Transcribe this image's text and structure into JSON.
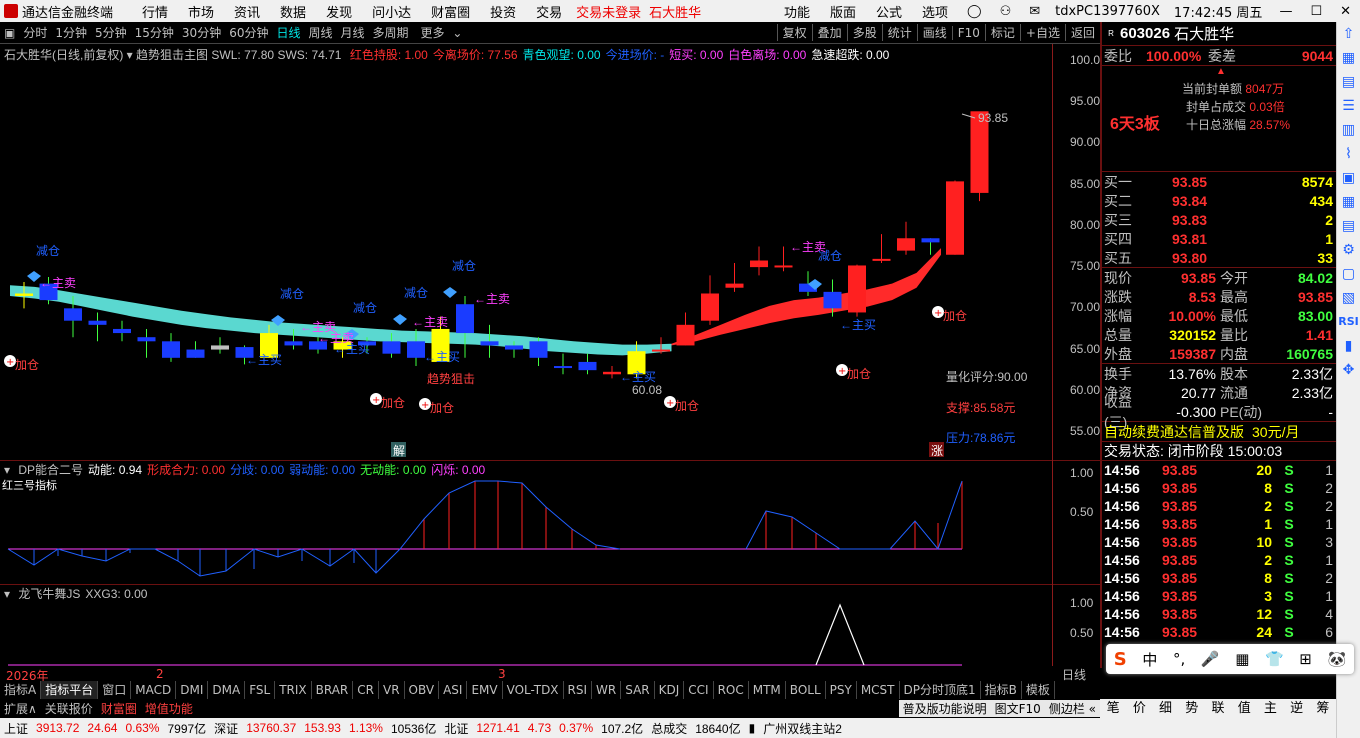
{
  "app": {
    "title": "通达信金融终端",
    "menus": [
      "行情",
      "市场",
      "资讯",
      "数据",
      "发现",
      "问小达",
      "财富圈",
      "投资",
      "交易"
    ],
    "trade_status": "交易未登录",
    "stock_header": "石大胜华",
    "right_menus": [
      "功能",
      "版面",
      "公式",
      "选项"
    ],
    "user": "tdxPC1397760X",
    "time": "17:42:45 周五"
  },
  "toolbar": {
    "periods": [
      "分时",
      "1分钟",
      "5分钟",
      "15分钟",
      "30分钟",
      "60分钟",
      "日线",
      "周线",
      "月线",
      "多周期",
      "更多"
    ],
    "selected": "日线",
    "buttons": [
      "复权",
      "叠加",
      "多股",
      "统计",
      "画线",
      "F10",
      "标记",
      "+自选",
      "返回"
    ]
  },
  "main": {
    "title": "石大胜华(日线,前复权)",
    "indicator": "趋势狙击主图",
    "swl": "SWL: 77.80",
    "sws": "SWS: 74.71",
    "legend": [
      {
        "t": "红色持股: 1.00",
        "c": "#ff3030"
      },
      {
        "t": "今离场价: 77.56",
        "c": "#ff3030"
      },
      {
        "t": "青色观望: 0.00",
        "c": "#00e5e5"
      },
      {
        "t": "今进场价: -",
        "c": "#2060ff"
      },
      {
        "t": "短买: 0.00",
        "c": "#ff40ff"
      },
      {
        "t": "白色离场: 0.00",
        "c": "#ff40ff"
      },
      {
        "t": "急速超跌: 0.00",
        "c": "#ffffff"
      }
    ],
    "y_ticks": [
      "100.0",
      "95.00",
      "90.00",
      "85.00",
      "80.00",
      "75.00",
      "70.00",
      "65.00",
      "60.00",
      "55.00"
    ],
    "annotations": {
      "max": "93.85",
      "min": "60.08",
      "score": "量化评分:90.00",
      "support": "支撑:85.58元",
      "pressure": "压力:78.86元",
      "trend": "趋势狙击",
      "jie": "解",
      "zhang": "涨",
      "jiacang": "加仓",
      "jiancang": "减仓",
      "zhumai": "←主卖",
      "zhumai2": "←主买"
    }
  },
  "sub1": {
    "legend": [
      {
        "t": "DP能合二号",
        "c": "#c0c0c0"
      },
      {
        "t": "动能: 0.94",
        "c": "#ffffff"
      },
      {
        "t": "形成合力: 0.00",
        "c": "#ff3030"
      },
      {
        "t": "分歧: 0.00",
        "c": "#2060ff"
      },
      {
        "t": "弱动能: 0.00",
        "c": "#2060ff"
      },
      {
        "t": "无动能: 0.00",
        "c": "#40ff40"
      },
      {
        "t": "闪烁: 0.00",
        "c": "#ff40ff"
      }
    ],
    "y_ticks": [
      "1.00",
      "0.50"
    ],
    "side_label": "红三号指标"
  },
  "sub2": {
    "legend": [
      {
        "t": "龙飞牛舞JS",
        "c": "#c0c0c0"
      },
      {
        "t": "XXG3: 0.00",
        "c": "#c0c0c0"
      }
    ],
    "y_ticks": [
      "1.00",
      "0.50"
    ]
  },
  "x_axis": {
    "year": "2026年",
    "m2": "2",
    "m3": "3",
    "label": "日线"
  },
  "right": {
    "code": "603026",
    "name": "石大胜华",
    "weibi": "委比",
    "weibi_v": "100.00%",
    "weicha": "委差",
    "weicha_v": "9044",
    "seal_label": "当前封单额",
    "seal_v": "8047万",
    "seal_ratio_label": "封单占成交",
    "seal_ratio_v": "0.03倍",
    "ten_day_label": "十日总涨幅",
    "ten_day_v": "28.57%",
    "board": "6天3板",
    "bids": [
      {
        "l": "买一",
        "p": "93.85",
        "v": "8574"
      },
      {
        "l": "买二",
        "p": "93.84",
        "v": "434"
      },
      {
        "l": "买三",
        "p": "93.83",
        "v": "2"
      },
      {
        "l": "买四",
        "p": "93.81",
        "v": "1"
      },
      {
        "l": "买五",
        "p": "93.80",
        "v": "33"
      }
    ],
    "stats": [
      {
        "a": "现价",
        "av": "93.85",
        "b": "今开",
        "bv": "84.02",
        "ac": "#ff3030",
        "bc": "#40ff40"
      },
      {
        "a": "涨跌",
        "av": "8.53",
        "b": "最高",
        "bv": "93.85",
        "ac": "#ff3030",
        "bc": "#ff3030"
      },
      {
        "a": "涨幅",
        "av": "10.00%",
        "b": "最低",
        "bv": "83.00",
        "ac": "#ff3030",
        "bc": "#40ff40"
      },
      {
        "a": "总量",
        "av": "320152",
        "b": "量比",
        "bv": "1.41",
        "ac": "#ffff00",
        "bc": "#ff3030"
      },
      {
        "a": "外盘",
        "av": "159387",
        "b": "内盘",
        "bv": "160765",
        "ac": "#ff3030",
        "bc": "#40ff40"
      }
    ],
    "stats2": [
      {
        "a": "换手",
        "av": "13.76%",
        "b": "股本",
        "bv": "2.33亿"
      },
      {
        "a": "净资",
        "av": "20.77",
        "b": "流通",
        "bv": "2.33亿"
      },
      {
        "a": "收益(三)",
        "av": "-0.300",
        "b": "PE(动)",
        "bv": "-"
      }
    ],
    "promo": "自动续费通达信普及版",
    "promo_price": "30元/月",
    "trade_state": "交易状态: 闭市阶段 15:00:03",
    "ticks": [
      {
        "t": "14:56",
        "p": "93.85",
        "v": "20",
        "s": "S",
        "n": "1"
      },
      {
        "t": "14:56",
        "p": "93.85",
        "v": "8",
        "s": "S",
        "n": "2"
      },
      {
        "t": "14:56",
        "p": "93.85",
        "v": "2",
        "s": "S",
        "n": "2"
      },
      {
        "t": "14:56",
        "p": "93.85",
        "v": "1",
        "s": "S",
        "n": "1"
      },
      {
        "t": "14:56",
        "p": "93.85",
        "v": "10",
        "s": "S",
        "n": "3"
      },
      {
        "t": "14:56",
        "p": "93.85",
        "v": "2",
        "s": "S",
        "n": "1"
      },
      {
        "t": "14:56",
        "p": "93.85",
        "v": "8",
        "s": "S",
        "n": "2"
      },
      {
        "t": "14:56",
        "p": "93.85",
        "v": "3",
        "s": "S",
        "n": "1"
      },
      {
        "t": "14:56",
        "p": "93.85",
        "v": "12",
        "s": "S",
        "n": "4"
      },
      {
        "t": "14:56",
        "p": "93.85",
        "v": "24",
        "s": "S",
        "n": "6"
      }
    ],
    "bottom_tabs": [
      "笔",
      "价",
      "细",
      "势",
      "联",
      "值",
      "主",
      "逆",
      "筹"
    ]
  },
  "tabs": [
    "指标A",
    "指标平台",
    "窗口",
    "MACD",
    "DMI",
    "DMA",
    "FSL",
    "TRIX",
    "BRAR",
    "CR",
    "VR",
    "OBV",
    "ASI",
    "EMV",
    "VOL-TDX",
    "RSI",
    "WR",
    "SAR",
    "KDJ",
    "CCI",
    "ROC",
    "MTM",
    "BOLL",
    "PSY",
    "MCST",
    "DP分时顶底1",
    "指标B",
    "模板"
  ],
  "bottom": {
    "items": [
      "扩展∧",
      "关联报价",
      "财富圈",
      "增值功能"
    ],
    "right_items": [
      "普及版功能说明",
      "图文F10",
      "侧边栏 «"
    ]
  },
  "status": {
    "sh": "上证",
    "sh_v": "3913.72",
    "sh_c": "24.64",
    "sh_p": "0.63%",
    "sh_a": "7997亿",
    "sz": "深证",
    "sz_v": "13760.37",
    "sz_c": "153.93",
    "sz_p": "1.13%",
    "sz_a": "10536亿",
    "bz": "北证",
    "bz_v": "1271.41",
    "bz_c": "4.73",
    "bz_p": "0.37%",
    "bz_a": "107.2亿",
    "total": "总成交",
    "total_v": "18640亿",
    "server": "广州双线主站2"
  },
  "ime": [
    "中",
    "°,",
    "🎤",
    "▦",
    "👕",
    "⊞",
    "🐼"
  ],
  "chart_data": {
    "type": "candlestick",
    "title": "石大胜华(日线,前复权)",
    "ylim": [
      53,
      101
    ],
    "candles": [
      [
        71.8,
        71.5,
        73.2,
        70.0
      ],
      [
        71.0,
        73.0,
        73.8,
        70.5
      ],
      [
        70.0,
        68.5,
        71.5,
        66.5
      ],
      [
        68.5,
        68.0,
        69.5,
        66.0
      ],
      [
        67.5,
        67.0,
        68.5,
        66.0
      ],
      [
        66.5,
        66.0,
        67.5,
        64.0
      ],
      [
        64.0,
        66.0,
        67.0,
        63.5
      ],
      [
        65.0,
        64.0,
        66.0,
        64.0
      ],
      [
        65.5,
        65.0,
        66.5,
        64.5
      ],
      [
        65.3,
        64.0,
        65.5,
        63.2
      ],
      [
        64.0,
        67.0,
        68.0,
        64.0
      ],
      [
        66.0,
        65.5,
        67.5,
        65.0
      ],
      [
        65.0,
        66.0,
        66.5,
        64.5
      ],
      [
        65.0,
        66.0,
        66.5,
        64.0
      ],
      [
        66.0,
        65.5,
        66.5,
        64.5
      ],
      [
        64.5,
        66.0,
        67.0,
        64.0
      ],
      [
        66.0,
        64.0,
        67.5,
        63.0
      ],
      [
        63.5,
        67.5,
        69.0,
        63.5
      ],
      [
        67.0,
        70.5,
        71.5,
        64.0
      ],
      [
        66.0,
        65.5,
        68.0,
        64.0
      ],
      [
        65.5,
        65.0,
        66.0,
        64.0
      ],
      [
        66.0,
        64.0,
        66.5,
        63.0
      ],
      [
        63.0,
        62.8,
        64.5,
        62.0
      ],
      [
        63.5,
        62.5,
        64.5,
        62.0
      ],
      [
        62.0,
        62.3,
        63.0,
        61.5
      ],
      [
        62.0,
        64.8,
        66.0,
        61.5
      ],
      [
        64.8,
        65.0,
        66.5,
        64.5
      ],
      [
        65.5,
        68.0,
        69.5,
        65.5
      ],
      [
        68.5,
        71.8,
        74.0,
        68.0
      ],
      [
        72.5,
        73.0,
        75.5,
        72.0
      ],
      [
        75.0,
        75.8,
        77.5,
        74.0
      ],
      [
        75.0,
        75.2,
        77.5,
        74.5
      ],
      [
        73.0,
        72.0,
        74.5,
        71.5
      ],
      [
        72.0,
        70.0,
        73.5,
        69.0
      ],
      [
        69.5,
        75.2,
        75.3,
        69.0
      ],
      [
        76.0,
        76.0,
        79.0,
        75.5
      ],
      [
        77.0,
        78.5,
        80.5,
        76.5
      ],
      [
        78.5,
        78.0,
        78.5,
        76.5
      ],
      [
        76.5,
        85.4,
        85.5,
        76.5
      ],
      [
        84.0,
        93.9,
        93.85,
        83.0
      ]
    ]
  }
}
